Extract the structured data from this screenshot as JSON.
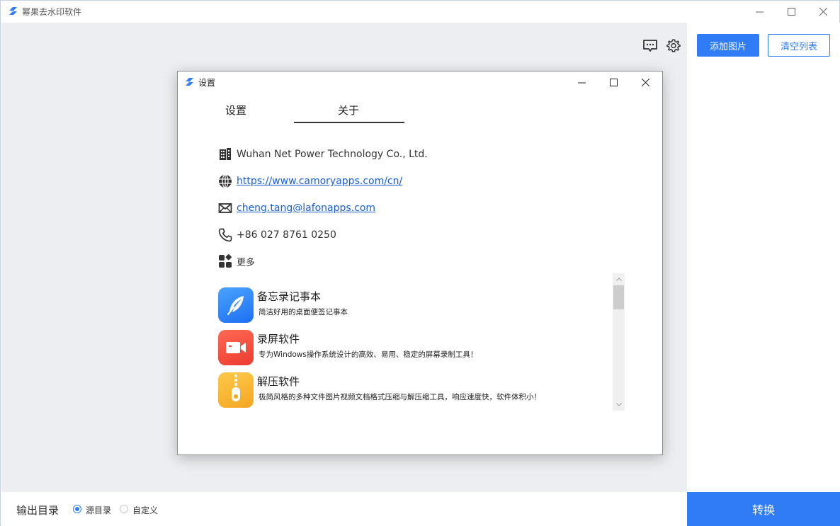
{
  "window": {
    "title": "幂果去水印软件",
    "minimize": "—",
    "maximize": "☐",
    "close": "✕"
  },
  "toolbar": {
    "add_image": "添加图片",
    "clear_list": "清空列表"
  },
  "bottom": {
    "output_label": "输出目录",
    "options": [
      "源目录",
      "自定义"
    ],
    "selected": "源目录",
    "convert": "转换"
  },
  "dialog": {
    "title": "设置",
    "tabs": [
      "设置",
      "关于"
    ],
    "active_tab": "关于",
    "company": "Wuhan Net Power Technology Co., Ltd.",
    "website": "https://www.camoryapps.com/cn/",
    "email": "cheng.tang@lafonapps.com",
    "phone": "+86 027 8761 0250",
    "more": "更多",
    "apps": [
      {
        "name": "备忘录记事本",
        "desc": "简洁好用的桌面便签记事本",
        "icon": "feather-icon",
        "color": "#2f7cf6"
      },
      {
        "name": "录屏软件",
        "desc": "专为Windows操作系统设计的高效、易用、稳定的屏幕录制工具！",
        "icon": "video-camera-icon",
        "color": "#f0453a"
      },
      {
        "name": "解压软件",
        "desc": "极简风格的多种文件图片视频文档格式压缩与解压缩工具，响应速度快，软件体积小！",
        "icon": "zipper-icon",
        "color": "#f6b530"
      }
    ]
  }
}
